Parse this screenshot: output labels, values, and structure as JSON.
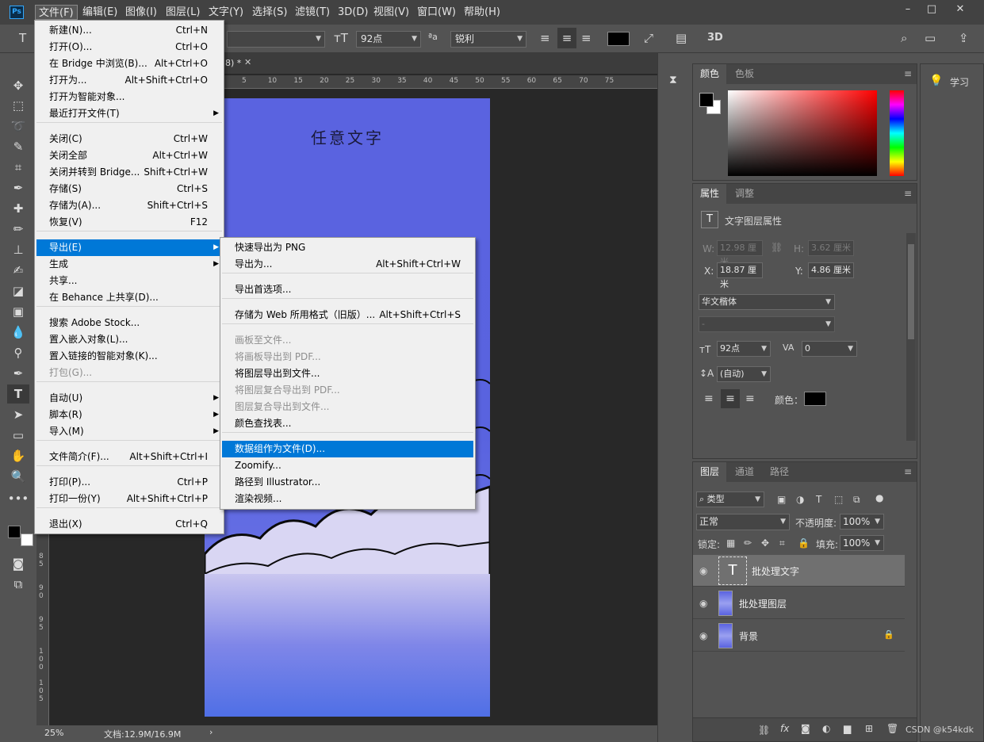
{
  "app": {
    "logo": "Ps",
    "menubar": [
      "文件(F)",
      "编辑(E)",
      "图像(I)",
      "图层(L)",
      "文字(Y)",
      "选择(S)",
      "滤镜(T)",
      "3D(D)",
      "视图(V)",
      "窗口(W)",
      "帮助(H)"
    ],
    "window_controls": [
      "–",
      "□",
      "✕"
    ]
  },
  "options": {
    "font_size": "92点",
    "aa_label": "ªa",
    "antialias": "锐利",
    "mode_3d": "3D"
  },
  "document": {
    "tab_title": "8) *",
    "ruler_marks": [
      "5",
      "10",
      "15",
      "20",
      "25",
      "30",
      "35",
      "40",
      "45",
      "50",
      "55",
      "60",
      "65",
      "70",
      "75"
    ],
    "ruler_left_marks": [
      "1\n0",
      "1\n5",
      "2\n0",
      "2\n5",
      "3\n0",
      "3\n5",
      "4\n0",
      "4\n5",
      "5\n0",
      "5\n5",
      "6\n0",
      "6\n5",
      "7\n0",
      "7\n5",
      "8\n0",
      "8\n5",
      "9\n0",
      "9\n5",
      "1\n0\n0",
      "1\n0\n5"
    ],
    "canvas_text": "任意文字",
    "zoom": "25%",
    "doc_size": "文档:12.9M/16.9M",
    "status_arrow": "›"
  },
  "file_menu": {
    "items": [
      {
        "label": "新建(N)...",
        "shortcut": "Ctrl+N"
      },
      {
        "label": "打开(O)...",
        "shortcut": "Ctrl+O"
      },
      {
        "label": "在 Bridge 中浏览(B)...",
        "shortcut": "Alt+Ctrl+O"
      },
      {
        "label": "打开为...",
        "shortcut": "Alt+Shift+Ctrl+O"
      },
      {
        "label": "打开为智能对象...",
        "shortcut": ""
      },
      {
        "label": "最近打开文件(T)",
        "shortcut": ""
      },
      {
        "label": "关闭(C)",
        "shortcut": "Ctrl+W"
      },
      {
        "label": "关闭全部",
        "shortcut": "Alt+Ctrl+W"
      },
      {
        "label": "关闭并转到 Bridge...",
        "shortcut": "Shift+Ctrl+W"
      },
      {
        "label": "存储(S)",
        "shortcut": "Ctrl+S"
      },
      {
        "label": "存储为(A)...",
        "shortcut": "Shift+Ctrl+S"
      },
      {
        "label": "恢复(V)",
        "shortcut": "F12"
      },
      {
        "label": "导出(E)",
        "shortcut": ""
      },
      {
        "label": "生成",
        "shortcut": ""
      },
      {
        "label": "共享...",
        "shortcut": ""
      },
      {
        "label": "在 Behance 上共享(D)...",
        "shortcut": ""
      },
      {
        "label": "搜索 Adobe Stock...",
        "shortcut": ""
      },
      {
        "label": "置入嵌入对象(L)...",
        "shortcut": ""
      },
      {
        "label": "置入链接的智能对象(K)...",
        "shortcut": ""
      },
      {
        "label": "打包(G)...",
        "shortcut": ""
      },
      {
        "label": "自动(U)",
        "shortcut": ""
      },
      {
        "label": "脚本(R)",
        "shortcut": ""
      },
      {
        "label": "导入(M)",
        "shortcut": ""
      },
      {
        "label": "文件简介(F)...",
        "shortcut": "Alt+Shift+Ctrl+I"
      },
      {
        "label": "打印(P)...",
        "shortcut": "Ctrl+P"
      },
      {
        "label": "打印一份(Y)",
        "shortcut": "Alt+Shift+Ctrl+P"
      },
      {
        "label": "退出(X)",
        "shortcut": "Ctrl+Q"
      }
    ]
  },
  "export_menu": {
    "items": [
      {
        "label": "快速导出为 PNG",
        "shortcut": ""
      },
      {
        "label": "导出为...",
        "shortcut": "Alt+Shift+Ctrl+W"
      },
      {
        "label": "导出首选项...",
        "shortcut": ""
      },
      {
        "label": "存储为 Web 所用格式（旧版）...",
        "shortcut": "Alt+Shift+Ctrl+S"
      },
      {
        "label": "画板至文件...",
        "shortcut": ""
      },
      {
        "label": "将画板导出到 PDF...",
        "shortcut": ""
      },
      {
        "label": "将图层导出到文件...",
        "shortcut": ""
      },
      {
        "label": "将图层复合导出到 PDF...",
        "shortcut": ""
      },
      {
        "label": "图层复合导出到文件...",
        "shortcut": ""
      },
      {
        "label": "颜色查找表...",
        "shortcut": ""
      },
      {
        "label": "数据组作为文件(D)...",
        "shortcut": ""
      },
      {
        "label": "Zoomify...",
        "shortcut": ""
      },
      {
        "label": "路径到 Illustrator...",
        "shortcut": ""
      },
      {
        "label": "渲染视频...",
        "shortcut": ""
      }
    ]
  },
  "color_panel": {
    "tabs": [
      "颜色",
      "色板"
    ]
  },
  "properties_panel": {
    "tabs": [
      "属性",
      "调整"
    ],
    "title": "文字图层属性",
    "w_label": "W:",
    "w_value": "12.98 厘米",
    "h_label": "H:",
    "h_value": "3.62 厘米",
    "x_label": "X:",
    "x_value": "18.87 厘米",
    "y_label": "Y:",
    "y_value": "4.86 厘米",
    "font_family": "华文楷体",
    "font_style": "-",
    "font_size": "92点",
    "tracking": "0",
    "leading": "(自动)",
    "color_label": "颜色："
  },
  "layers_panel": {
    "tabs": [
      "图层",
      "通道",
      "路径"
    ],
    "filter": "类型",
    "blend_mode": "正常",
    "opacity_label": "不透明度:",
    "opacity": "100%",
    "lock_label": "锁定:",
    "fill_label": "填充:",
    "fill": "100%",
    "layers": [
      {
        "name": "批处理文字",
        "type": "text"
      },
      {
        "name": "批处理图层",
        "type": "image"
      },
      {
        "name": "背景",
        "type": "image"
      }
    ]
  },
  "learn": {
    "label": "学习"
  },
  "watermark": "CSDN @k54kdk",
  "colors": {
    "accent": "#0078d7",
    "foreground": "#000000",
    "background": "#ffffff"
  }
}
